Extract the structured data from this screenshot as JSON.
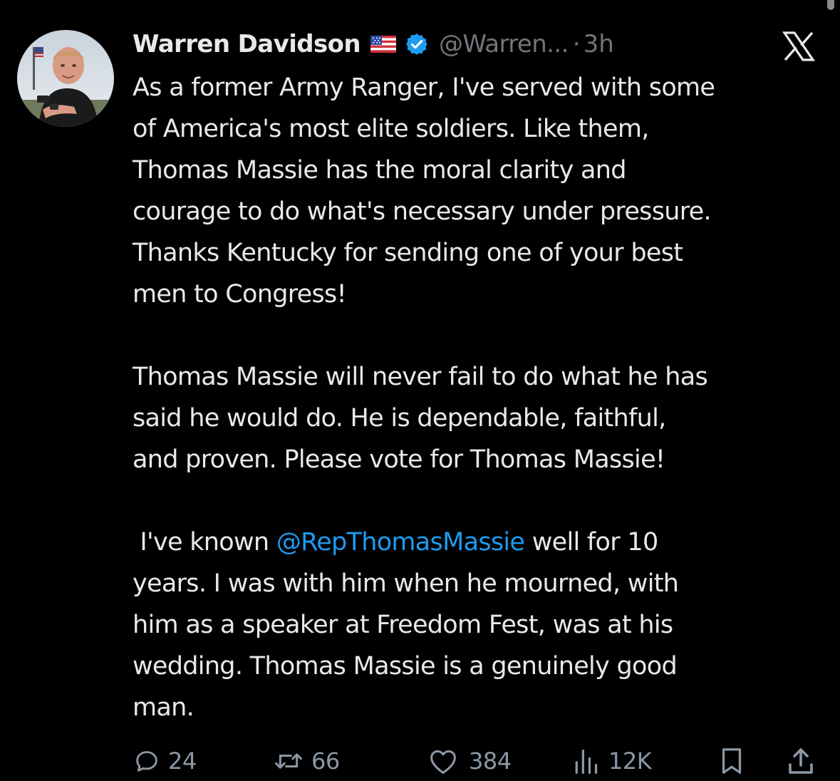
{
  "tweet": {
    "author": {
      "display_name": "Warren Davidson",
      "flag_emoji": "🇺🇸",
      "handle": "@Warren...",
      "avatar_alt": "Warren Davidson profile photo"
    },
    "separator": "·",
    "timestamp": "3h",
    "platform_icon": "x-logo-icon",
    "paragraphs": [
      [
        "As a former Army Ranger, I've served with some",
        "of America's most elite soldiers. Like them,",
        "Thomas Massie has the moral clarity and",
        "courage to do what's necessary under pressure.",
        "Thanks Kentucky for sending one of your best",
        "men to Congress!"
      ],
      [
        "Thomas Massie will never fail to do what he has",
        "said he would do. He is dependable, faithful,",
        "and proven. Please vote for Thomas Massie!"
      ]
    ],
    "paragraph3": {
      "prefix": " I've known ",
      "mention": "@RepThomasMassie",
      "suffix": " well for 10",
      "lines": [
        "years. I was with him when he mourned, with",
        "him as a speaker at Freedom Fest, was at his",
        "wedding. Thomas Massie is a genuinely good",
        "man."
      ]
    },
    "actions": {
      "replies": "24",
      "reposts": "66",
      "likes": "384",
      "views": "12K"
    },
    "colors": {
      "background": "#000000",
      "text": "#e7e9ea",
      "secondary": "#71767b",
      "link": "#1d9bf0",
      "verified": "#1d9bf0"
    }
  }
}
